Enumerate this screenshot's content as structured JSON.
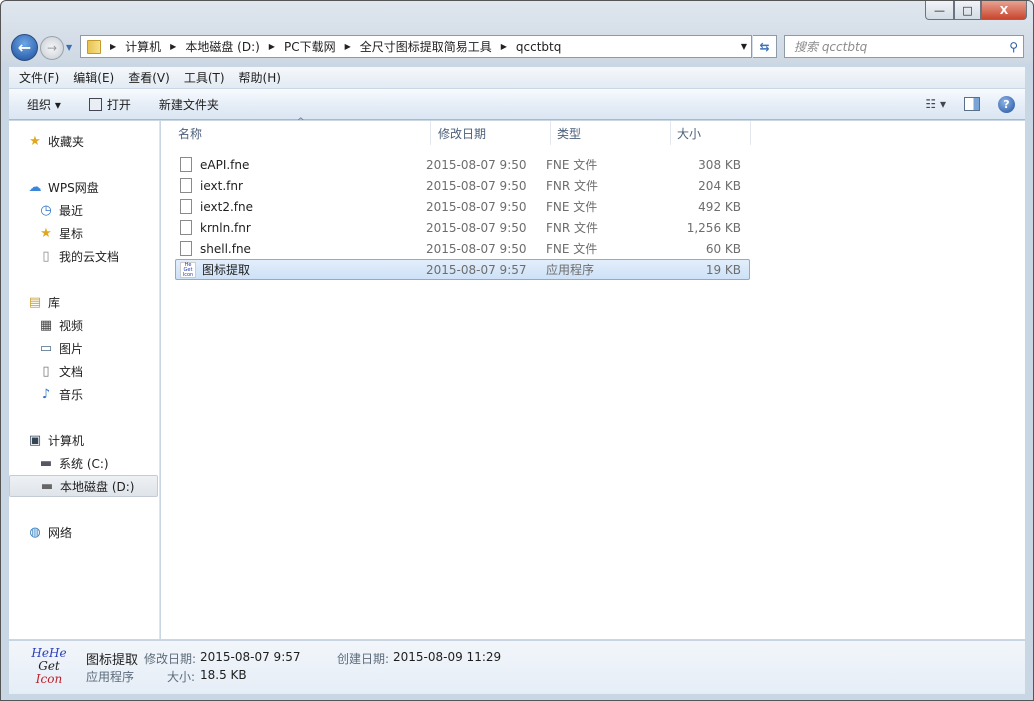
{
  "window": {
    "min": "—",
    "max": "□",
    "close": "X"
  },
  "address": {
    "crumbs": [
      "计算机",
      "本地磁盘 (D:)",
      "PC下载网",
      "全尺寸图标提取简易工具",
      "qcctbtq"
    ]
  },
  "search": {
    "placeholder": "搜索 qcctbtq"
  },
  "menu": [
    "文件(F)",
    "编辑(E)",
    "查看(V)",
    "工具(T)",
    "帮助(H)"
  ],
  "toolbar": {
    "organize": "组织 ▾",
    "open": "打开",
    "new_folder": "新建文件夹",
    "views": "☷ ▾",
    "help": "?"
  },
  "sidebar": [
    {
      "label": "收藏夹",
      "icon": "★"
    },
    {
      "label": "WPS网盘",
      "icon": "☁"
    },
    {
      "label": "最近",
      "icon": "◷"
    },
    {
      "label": "星标",
      "icon": "★"
    },
    {
      "label": "我的云文档",
      "icon": "▯"
    },
    {
      "label": "库",
      "icon": "▤"
    },
    {
      "label": "视频",
      "icon": "▦"
    },
    {
      "label": "图片",
      "icon": "▭"
    },
    {
      "label": "文档",
      "icon": "▯"
    },
    {
      "label": "音乐",
      "icon": "♪"
    },
    {
      "label": "计算机",
      "icon": "▣"
    },
    {
      "label": "系统 (C:)",
      "icon": "▬"
    },
    {
      "label": "本地磁盘 (D:)",
      "icon": "▬"
    },
    {
      "label": "网络",
      "icon": "◍"
    }
  ],
  "columns": [
    "名称",
    "修改日期",
    "类型",
    "大小"
  ],
  "files": [
    {
      "name": "eAPI.fne",
      "date": "2015-08-07 9:50",
      "type": "FNE 文件",
      "size": "308 KB"
    },
    {
      "name": "iext.fnr",
      "date": "2015-08-07 9:50",
      "type": "FNR 文件",
      "size": "204 KB"
    },
    {
      "name": "iext2.fne",
      "date": "2015-08-07 9:50",
      "type": "FNE 文件",
      "size": "492 KB"
    },
    {
      "name": "krnln.fnr",
      "date": "2015-08-07 9:50",
      "type": "FNR 文件",
      "size": "1,256 KB"
    },
    {
      "name": "shell.fne",
      "date": "2015-08-07 9:50",
      "type": "FNE 文件",
      "size": "60 KB"
    },
    {
      "name": "图标提取",
      "date": "2015-08-07 9:57",
      "type": "应用程序",
      "size": "19 KB"
    }
  ],
  "details": {
    "logo": [
      "HeHe",
      "Get",
      "Icon"
    ],
    "name": "图标提取",
    "type": "应用程序",
    "modified_label": "修改日期:",
    "modified": "2015-08-07 9:57",
    "created_label": "创建日期:",
    "created": "2015-08-09 11:29",
    "size_label": "大小:",
    "size": "18.5 KB"
  }
}
